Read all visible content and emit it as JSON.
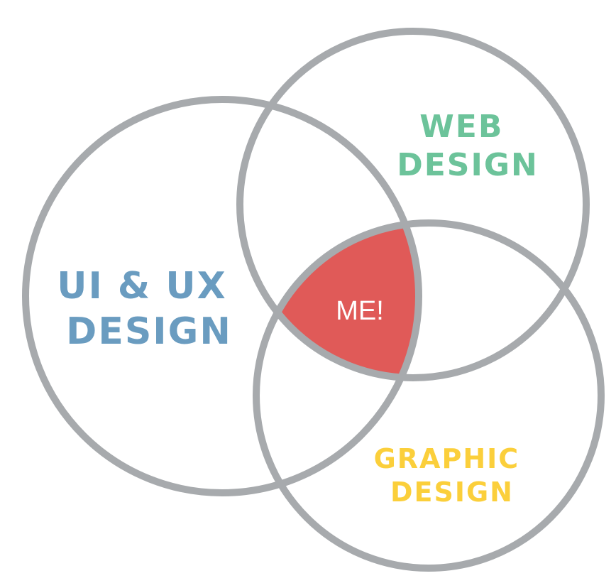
{
  "diagram": {
    "type": "venn",
    "sets": [
      {
        "id": "ui-ux",
        "label_lines": [
          "UI & UX",
          "DESIGN"
        ],
        "color": "#6a9cc0"
      },
      {
        "id": "web",
        "label_lines": [
          "WEB",
          "DESIGN"
        ],
        "color": "#6cc39a"
      },
      {
        "id": "graphic",
        "label_lines": [
          "GRAPHIC",
          "DESIGN"
        ],
        "color": "#fbcf3b"
      }
    ],
    "intersection": {
      "label": "ME!",
      "fill_color": "#e05a58",
      "text_color": "#ffffff"
    },
    "outline_color": "#a7aaad"
  }
}
